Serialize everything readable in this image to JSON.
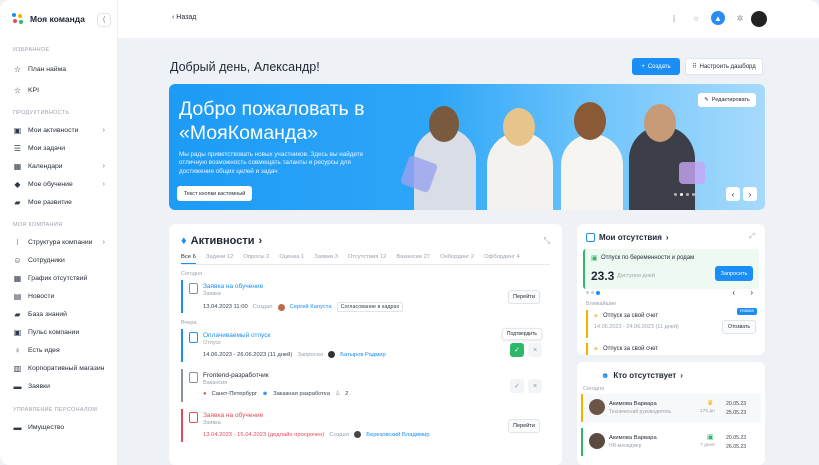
{
  "app": {
    "name": "Моя команда"
  },
  "sidebar": {
    "sections": [
      {
        "title": "ИЗБРАННОЕ",
        "items": [
          {
            "label": "План найма",
            "icon": "star-icon"
          },
          {
            "label": "KPI",
            "icon": "star-icon"
          }
        ]
      },
      {
        "title": "ПРОДУКТИВНОСТЬ",
        "items": [
          {
            "label": "Мои активности",
            "icon": "chart-icon"
          },
          {
            "label": "Мои задачи",
            "icon": "list-icon"
          },
          {
            "label": "Календари",
            "icon": "calendar-icon"
          },
          {
            "label": "Мое обучение",
            "icon": "graduation-cap-icon"
          },
          {
            "label": "Мое развитие",
            "icon": "book-icon"
          }
        ]
      },
      {
        "title": "МОЯ КОМПАНИЯ",
        "items": [
          {
            "label": "Структура компании",
            "icon": "hierarchy-icon"
          },
          {
            "label": "Сотрудники",
            "icon": "people-icon"
          },
          {
            "label": "График отсутствий",
            "icon": "calendar-icon"
          },
          {
            "label": "Новости",
            "icon": "news-icon"
          },
          {
            "label": "База знаний",
            "icon": "book-icon"
          },
          {
            "label": "Пульс компании",
            "icon": "pulse-icon"
          },
          {
            "label": "Есть идея",
            "icon": "lightbulb-icon"
          },
          {
            "label": "Корпоративный магазин",
            "icon": "cart-icon"
          },
          {
            "label": "Заявки",
            "icon": "folder-icon"
          }
        ]
      },
      {
        "title": "УПРАВЛЕНИЕ ПЕРСОНАЛОМ",
        "items": [
          {
            "label": "Имущество",
            "icon": "box-icon"
          }
        ]
      }
    ]
  },
  "topbar": {
    "back_label": "Назад"
  },
  "header": {
    "greeting": "Добрый день, Александр!",
    "create_label": "Создать",
    "dashboard_label": "Настроить дашборд"
  },
  "banner": {
    "title": "Добро пожаловать в «МояКоманда»",
    "text": "Мы рады приветствовать новых участников. Здесь вы найдете отличную возможность совмещать таланты и ресурсы для достижения общих целей и задач",
    "cta_label": "Текст кнопки кастомный",
    "edit_label": "Редактировать"
  },
  "activities": {
    "title": "Активности",
    "tabs": [
      "Все 6",
      "Задачи 12",
      "Опросы 2",
      "Оценка 1",
      "Заявки 3",
      "Отсутствия 12",
      "Вакансии 27",
      "Онбординг 2",
      "Офбординг 4"
    ],
    "group_today": "Сегодня",
    "group_yesterday": "Вчера",
    "items": [
      {
        "title": "Заявка на обучение",
        "type": "Заявка",
        "date": "13.04.2023 11:00",
        "created_label": "Создал",
        "person": "Сергей Капуста",
        "tag": "Согласование в кадрах",
        "action": "Перейти"
      },
      {
        "title": "Оплачиваемый отпуск",
        "type": "Отпуск",
        "date": "14.06.2023 - 26.06.2023 (11 дней)",
        "created_label": "Запросил",
        "person": "Батыров Радмир",
        "tooltip": "Подтвердить"
      },
      {
        "title": "Frontend-разработчик",
        "type": "Вакансия",
        "city": "Санкт-Петербург",
        "team": "Заказная разработка",
        "count": "2"
      },
      {
        "title": "Заявка на обучение",
        "type": "Заявка",
        "date": "13.04.2023 - 15.04.2023 (дедлайн просрочен)",
        "created_label": "Создал",
        "person": "Березовский Владимир",
        "action": "Перейти"
      }
    ]
  },
  "absences": {
    "title": "Мои отсутствия",
    "main_label": "Отпуск по беременности и родам",
    "days": "23.3",
    "days_label": "Доступно дней",
    "request_label": "Запросить",
    "upcoming_label": "Ближайшие",
    "new_badge": "Новое",
    "upcoming": [
      {
        "title": "Отпуск за свой счет",
        "dates": "14.06.2023 - 24.06.2023 (11 дней)",
        "action": "Отозвать"
      },
      {
        "title": "Отпуск за свой счет",
        "dates": ""
      }
    ]
  },
  "who_absent": {
    "title": "Кто отсутствует",
    "group": "Сегодня",
    "people": [
      {
        "name": "Акимова Варвара",
        "role": "Технический руководитель",
        "days": "176 дн",
        "from": "20.05.23",
        "to": "25.05.23"
      },
      {
        "name": "Акимова Варвара",
        "role": "HR-менеджер",
        "days": "7 дней",
        "from": "20.05.23",
        "to": "26.05.23"
      }
    ]
  },
  "colors": {
    "accent": "#1a8ef5",
    "success": "#2fb86a",
    "warning": "#f0b400",
    "danger": "#e8495a"
  }
}
